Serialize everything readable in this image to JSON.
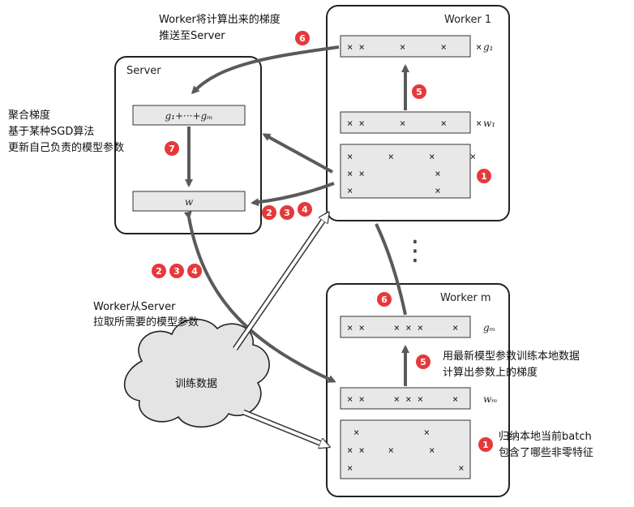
{
  "server": {
    "title": "Server",
    "gradient_sum": "g₁+···+gₘ",
    "weight": "w"
  },
  "worker1": {
    "title": "Worker 1",
    "g_label": "g₁",
    "w_label": "w₁",
    "g_row": "× ×      ×      ×     ×",
    "w_row": "× ×      ×      ×     ×",
    "data_rows": [
      "×      ×      ×      ×",
      "× ×            ×",
      "×              ×"
    ]
  },
  "workerm": {
    "title": "Worker m",
    "g_label": "gₘ",
    "w_label": "wₘ",
    "g_row": "× ×     × × ×     ×",
    "w_row": "× ×     × × ×     ×",
    "data_rows": [
      "×           ×",
      "× ×    ×      ×",
      "×                  ×"
    ]
  },
  "ellipsis": "⋮",
  "training_data": "训练数据",
  "notes": {
    "push": [
      "Worker将计算出来的梯度",
      "推送至Server"
    ],
    "aggregate": [
      "聚合梯度",
      "基于某种SGD算法",
      "更新自己负责的模型参数"
    ],
    "pull": [
      "Worker从Server",
      "拉取所需要的模型参数"
    ],
    "compute": [
      "用最新模型参数训练本地数据",
      "计算出参数上的梯度"
    ],
    "features": [
      "归纳本地当前batch",
      "包含了哪些非零特征"
    ]
  },
  "badges": {
    "b1_top": "1",
    "b5_top": "5",
    "b6_top": "6",
    "b7": "7",
    "b2_a": "2",
    "b3_a": "3",
    "b4_a": "4",
    "b2_b": "2",
    "b3_b": "3",
    "b4_b": "4",
    "b6_bot": "6",
    "b5_bot": "5",
    "b1_bot": "1"
  },
  "colors": {
    "badge": "#e5393b",
    "arrow": "#5a5a5a",
    "box_fill": "#e8e8e8",
    "cloud": "#e4e4e4"
  }
}
